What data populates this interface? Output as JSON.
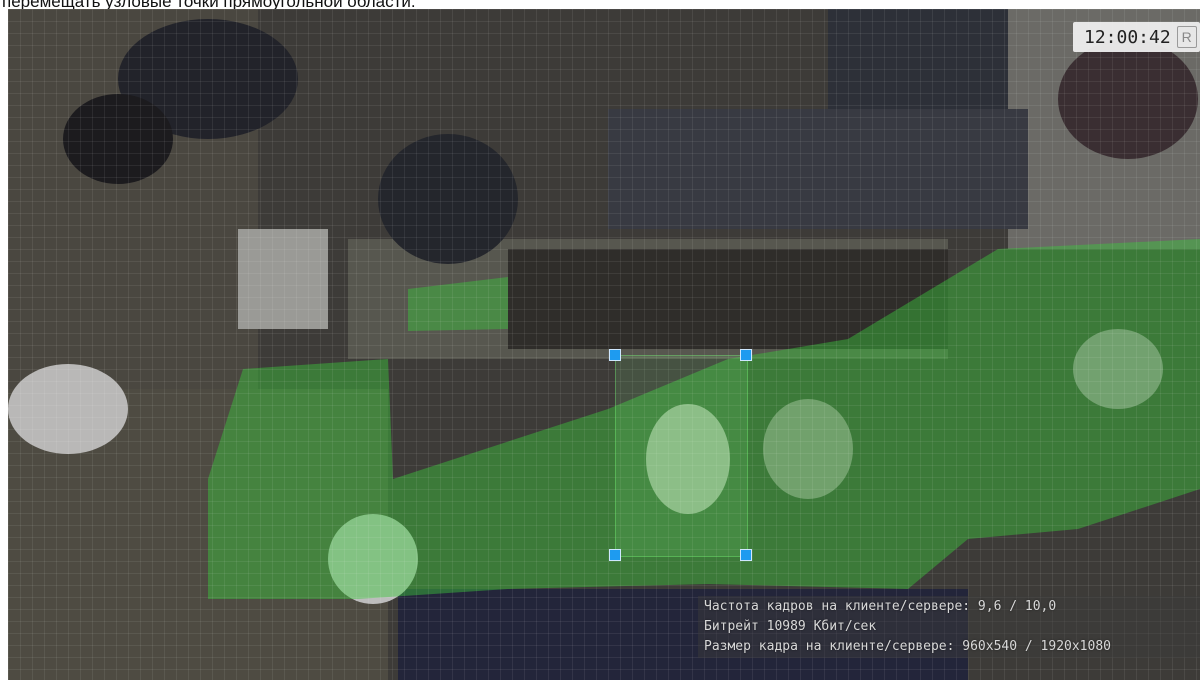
{
  "caption": "перемещать узловые точки прямоугольной области.",
  "overlay": {
    "time": "12:00:42",
    "record_badge": "R"
  },
  "stats": {
    "frame_rate": "Частота кадров на клиенте/сервере: 9,6 / 10,0",
    "bitrate": "Битрейт 10989 Кбит/сек",
    "frame_size": "Размер кадра на клиенте/сервере: 960x540 / 1920x1080"
  },
  "colors": {
    "detection": "#3cc83c",
    "handle": "#1e9bf0"
  }
}
